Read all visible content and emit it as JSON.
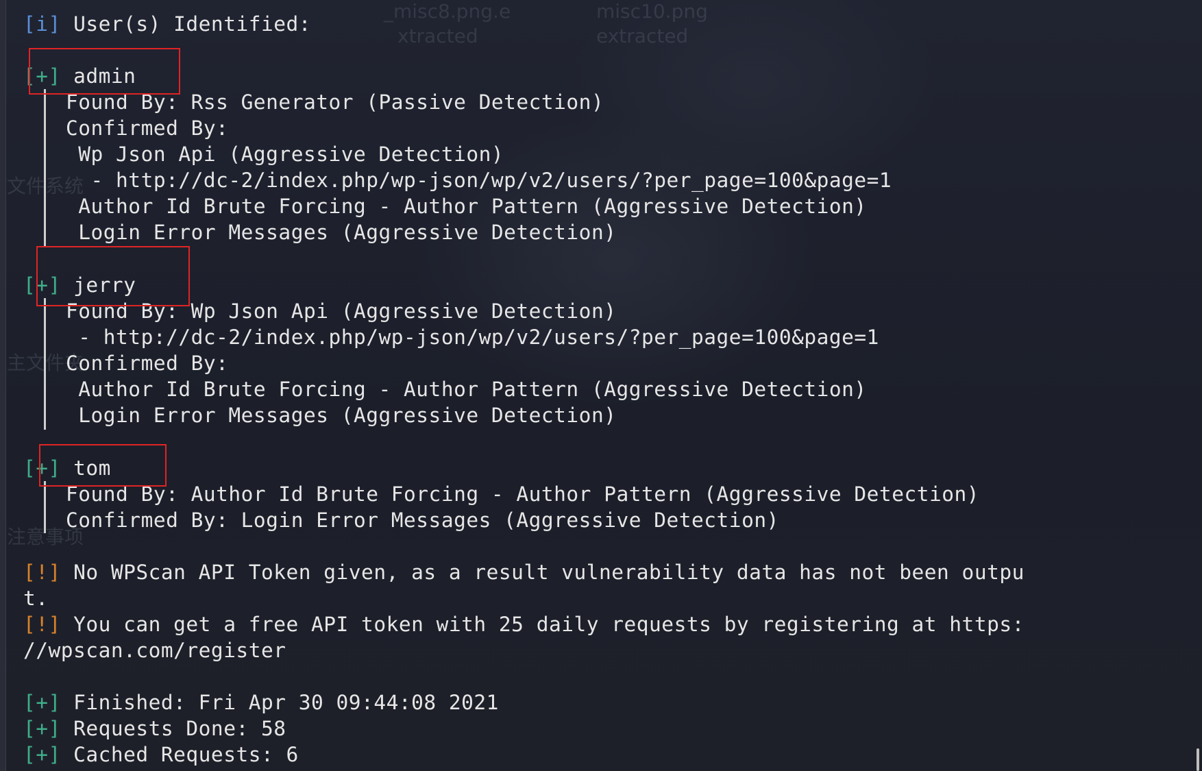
{
  "ghost": [
    "_misc8.png.e",
    "xtracted",
    "misc10.png",
    "extracted",
    "文件系统",
    "主文件夹",
    "注意事项"
  ],
  "tags": {
    "info": "[i]",
    "plus": "[+]",
    "warn": "[!]"
  },
  "header": "User(s) Identified:",
  "users": [
    {
      "name": "admin",
      "lines": [
        "Found By: Rss Generator (Passive Detection)",
        "Confirmed By:",
        " Wp Json Api (Aggressive Detection)",
        "  - http://dc-2/index.php/wp-json/wp/v2/users/?per_page=100&page=1",
        " Author Id Brute Forcing - Author Pattern (Aggressive Detection)",
        " Login Error Messages (Aggressive Detection)"
      ]
    },
    {
      "name": "jerry",
      "lines": [
        "Found By: Wp Json Api (Aggressive Detection)",
        " - http://dc-2/index.php/wp-json/wp/v2/users/?per_page=100&page=1",
        "Confirmed By:",
        " Author Id Brute Forcing - Author Pattern (Aggressive Detection)",
        " Login Error Messages (Aggressive Detection)"
      ]
    },
    {
      "name": "tom",
      "lines": [
        "Found By: Author Id Brute Forcing - Author Pattern (Aggressive Detection)",
        "Confirmed By: Login Error Messages (Aggressive Detection)"
      ]
    }
  ],
  "warnings": [
    {
      "text": "No WPScan API Token given, as a result vulnerability data has not been outpu",
      "wrap": "t."
    },
    {
      "text": "You can get a free API token with 25 daily requests by registering at https:",
      "wrap": "//wpscan.com/register"
    }
  ],
  "summary": [
    "Finished: Fri Apr 30 09:44:08 2021",
    "Requests Done: 58",
    "Cached Requests: 6"
  ],
  "colors": {
    "background": "#1c1f2a",
    "text": "#e6e6e6",
    "info_tag": "#5a8fd6",
    "plus_tag": "#3fae8a",
    "warn_tag": "#d9822b",
    "highlight_box": "#e02424"
  }
}
